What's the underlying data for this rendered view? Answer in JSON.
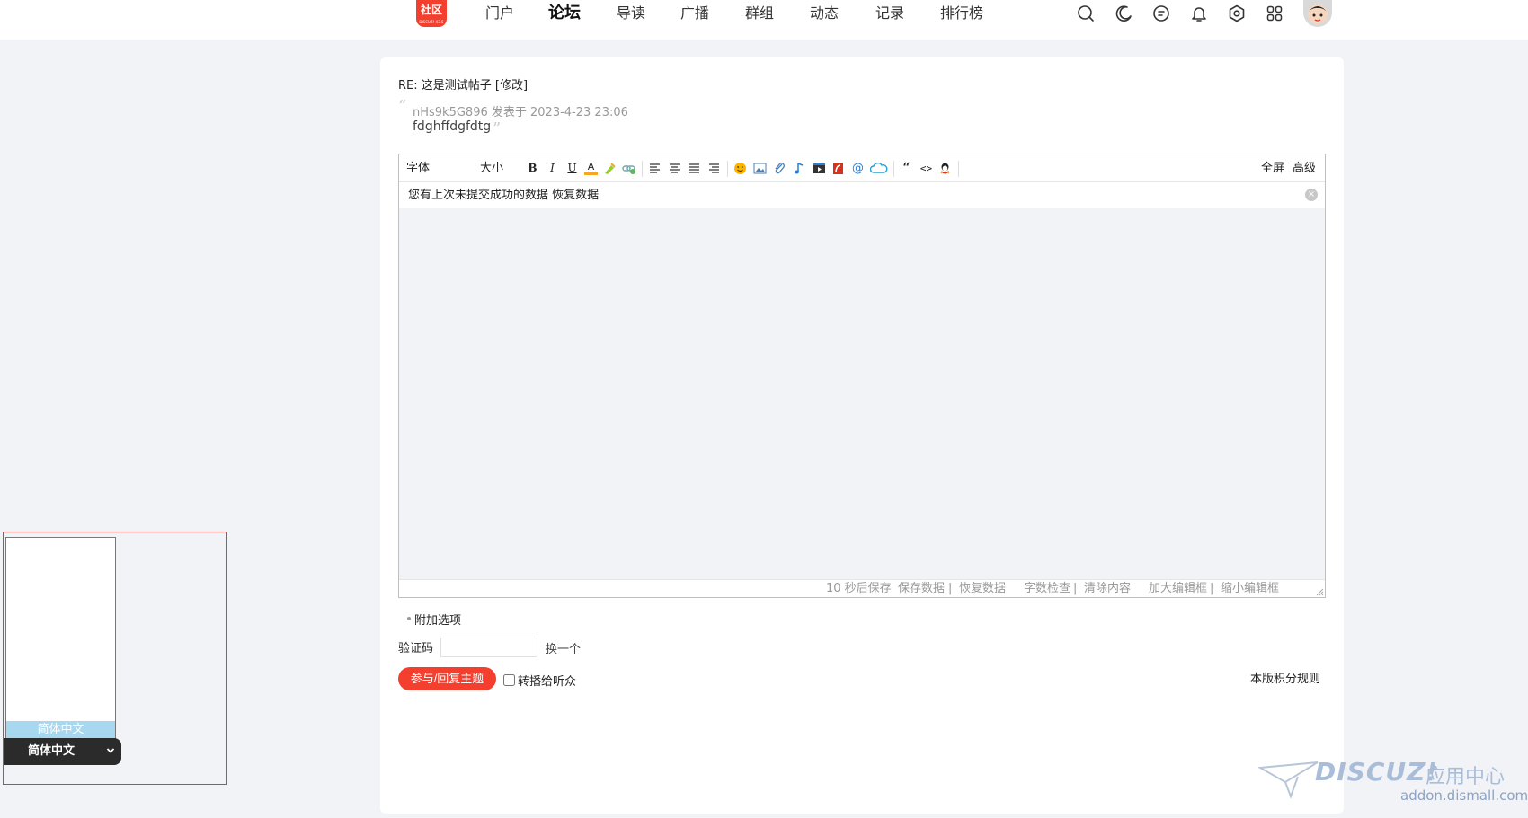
{
  "topnav": {
    "logo_text": "社区",
    "logo_subtext": "DISCUZ! X3.5",
    "items": [
      "门户",
      "论坛",
      "导读",
      "广播",
      "群组",
      "动态",
      "记录",
      "排行榜"
    ],
    "active": "论坛",
    "icons": [
      "search-icon",
      "moon-icon",
      "message-icon",
      "bell-icon",
      "settings-icon",
      "grid-icon"
    ]
  },
  "post": {
    "title": "RE: 这是测试帖子 [修改]",
    "quote_open": "“",
    "quote_meta": "nHs9k5G896 发表于 2023-4-23 23:06",
    "quote_body": "fdghffdgfdtg",
    "quote_close": "”"
  },
  "editor": {
    "font_label": "字体",
    "size_label": "大小",
    "bold": "B",
    "italic": "I",
    "underline": "U",
    "color_a": "A",
    "at": "@",
    "quote_glyph": "“",
    "code_glyph": "<>",
    "fullscreen_label": "全屏",
    "advanced_label": "高级",
    "notice": "您有上次未提交成功的数据 恢复数据",
    "notice_close": "×",
    "status": {
      "autosave": "10 秒后保存",
      "save": "保存数据",
      "sep": "|",
      "restore": "恢复数据",
      "wordcount": "字数检查",
      "clear": "清除内容",
      "enlarge": "加大编辑框",
      "shrink": "缩小编辑框"
    }
  },
  "form": {
    "extra_options": "附加选项",
    "captcha_label": "验证码",
    "captcha_value": "",
    "captcha_change": "换一个",
    "submit": "参与/回复主题",
    "relay_label": "转播给听众",
    "rules": "本版积分规则"
  },
  "language": {
    "option": "简体中文",
    "selected": "简体中文"
  },
  "watermark": {
    "brand": "DISCUZ!",
    "cn": "应用中心",
    "url": "addon.dismall.com"
  },
  "colors": {
    "accent": "#f43f2e",
    "page_bg": "#f2f3f7"
  }
}
